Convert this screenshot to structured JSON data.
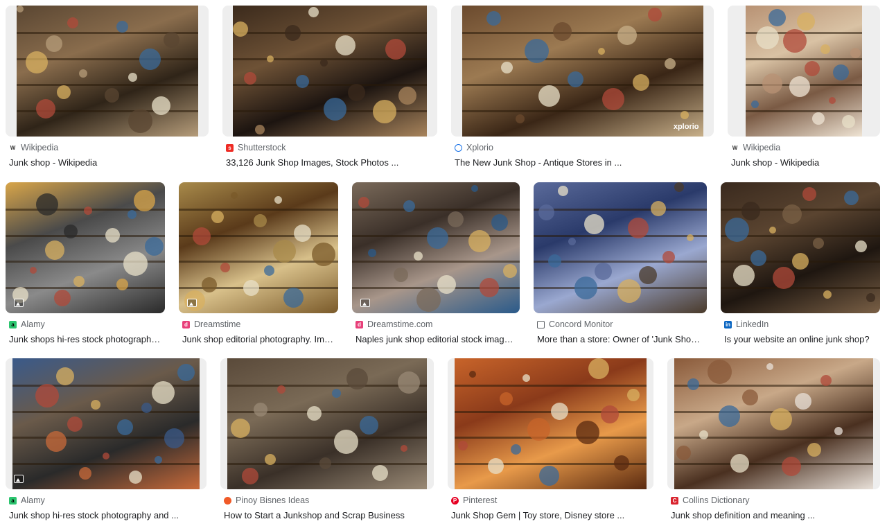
{
  "results": [
    {
      "source": "Wikipedia",
      "favicon": "wikipedia-icon",
      "title": "Junk shop - Wikipedia",
      "colors": [
        "#5a4632",
        "#8a6d4d",
        "#2f2418",
        "#b59c7a"
      ]
    },
    {
      "source": "Shutterstock",
      "favicon": "shutterstock-icon",
      "title": "33,126 Junk Shop Images, Stock Photos ...",
      "colors": [
        "#3b2a1c",
        "#6e5236",
        "#1c1410",
        "#a8845c"
      ]
    },
    {
      "source": "Xplorio",
      "favicon": "globe-icon",
      "title": "The New Junk Shop - Antique Stores in ...",
      "colors": [
        "#6b4a2e",
        "#9c7a52",
        "#3a2616",
        "#c8b08a"
      ],
      "watermark": "xplorio"
    },
    {
      "source": "Wikipedia",
      "favicon": "wikipedia-icon",
      "title": "Junk shop - Wikipedia",
      "colors": [
        "#b89274",
        "#d9c2a4",
        "#7a5a44",
        "#efe4d4"
      ]
    },
    {
      "source": "Alamy",
      "favicon": "alamy-icon",
      "title": "Junk shops hi-res stock photography and ...",
      "colors": [
        "#d9a64a",
        "#4a4a4a",
        "#8a8a8a",
        "#2a2a2a"
      ]
    },
    {
      "source": "Dreamstime",
      "favicon": "dreamstime-icon",
      "title": "Junk shop editorial photography. Image of ...",
      "colors": [
        "#a88a4a",
        "#5a3a1a",
        "#d8c08a",
        "#7a5a2a"
      ]
    },
    {
      "source": "Dreamstime.com",
      "favicon": "dreamstime-icon",
      "title": "Naples junk shop editorial stock image ...",
      "colors": [
        "#7a6a5a",
        "#3a2f28",
        "#a8968a",
        "#2a5a8a"
      ]
    },
    {
      "source": "Concord Monitor",
      "favicon": "page-icon",
      "title": "More than a store: Owner of 'Junk Shop ...",
      "colors": [
        "#5a6a9a",
        "#2a3a6a",
        "#9aa8d0",
        "#4a3a2a"
      ]
    },
    {
      "source": "LinkedIn",
      "favicon": "linkedin-icon",
      "title": "Is your website an online junk shop?",
      "colors": [
        "#3a2a1e",
        "#5a4430",
        "#1e1610",
        "#7a6046"
      ]
    },
    {
      "source": "Alamy",
      "favicon": "alamy-icon",
      "title": "Junk shop hi-res stock photography and ...",
      "colors": [
        "#3a5a8a",
        "#6a5a4a",
        "#2a2a2a",
        "#c86a3a"
      ]
    },
    {
      "source": "Pinoy Bisnes Ideas",
      "favicon": "pinoy-icon",
      "title": "How to Start a Junkshop and Scrap Business",
      "colors": [
        "#5a4a3a",
        "#7a6a56",
        "#3a3028",
        "#9a8a76"
      ]
    },
    {
      "source": "Pinterest",
      "favicon": "pinterest-icon",
      "title": "Junk Shop Gem | Toy store, Disney store ...",
      "colors": [
        "#c8642a",
        "#8a3a1a",
        "#e89a4a",
        "#5a2a10"
      ]
    },
    {
      "source": "Collins Dictionary",
      "favicon": "collins-icon",
      "title": "Junk shop definition and meaning ...",
      "colors": [
        "#8a5a3a",
        "#c8a888",
        "#4a3020",
        "#e8e0d8"
      ]
    }
  ],
  "favicon_colors": {
    "wikipedia-icon": "#ffffff",
    "shutterstock-icon": "#ee2b24",
    "globe-icon": "#ffffff",
    "alamy-icon": "#2cc56f",
    "dreamstime-icon": "#e8407a",
    "page-icon": "#ffffff",
    "linkedin-icon": "#0a66c2",
    "pinoy-icon": "#f05a28",
    "pinterest-icon": "#e60023",
    "collins-icon": "#d9232e"
  }
}
